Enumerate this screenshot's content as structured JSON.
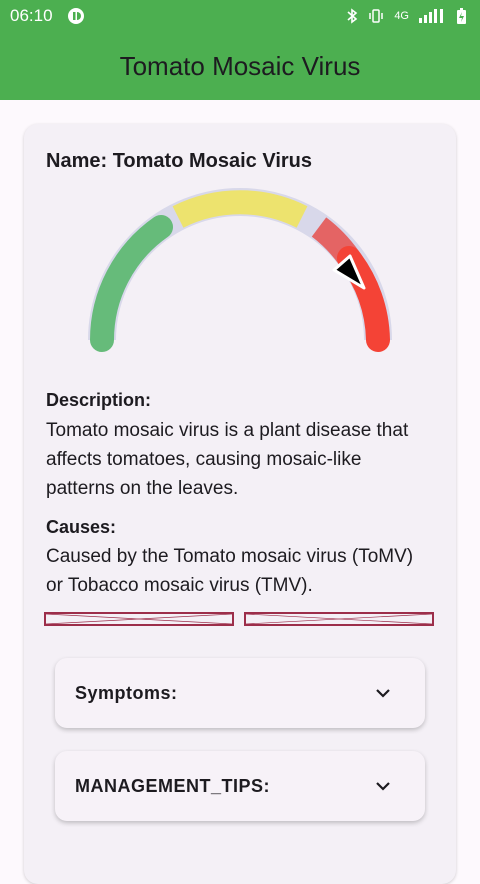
{
  "status": {
    "time": "06:10",
    "network": "4G"
  },
  "appbar": {
    "title": "Tomato Mosaic Virus"
  },
  "card": {
    "name_label": "Name: Tomato Mosaic Virus",
    "gauge": {
      "level": 0.82,
      "colors": [
        "#66bb7a",
        "#ede36e",
        "#e46464",
        "#f44336"
      ]
    },
    "description_heading": "Description:",
    "description_text": "Tomato mosaic virus is a plant disease that affects tomatoes, causing mosaic-like patterns on the leaves.",
    "causes_heading": "Causes:",
    "causes_text": "Caused by the Tomato mosaic virus (ToMV) or Tobacco mosaic virus (TMV)."
  },
  "sections": [
    {
      "label": "Symptoms:"
    },
    {
      "label": "MANAGEMENT_TIPS:"
    }
  ]
}
